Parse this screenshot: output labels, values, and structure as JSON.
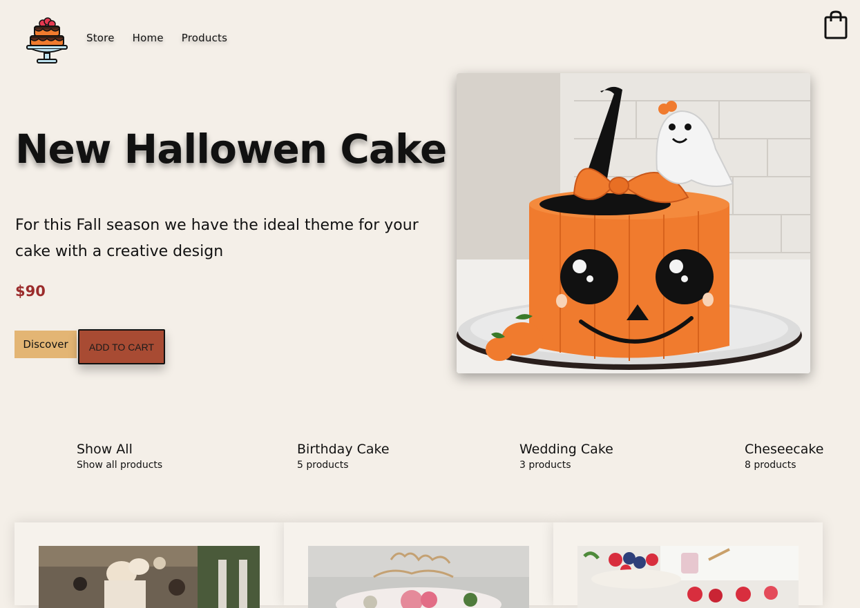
{
  "nav": {
    "items": [
      "Store",
      "Home",
      "Products"
    ]
  },
  "icons": {
    "logo": "cake-logo-icon",
    "cart": "shopping-bag-icon"
  },
  "hero": {
    "title": "New Hallowen Cake",
    "description": "For this Fall season we have the ideal theme for your cake with a creative design",
    "price": "$90",
    "discover_label": "Discover",
    "add_to_cart_label": "ADD TO CART"
  },
  "categories": [
    {
      "name": "Show All",
      "count": "Show all products"
    },
    {
      "name": "Birthday Cake",
      "count": "5 products"
    },
    {
      "name": "Wedding Cake",
      "count": "3 products"
    },
    {
      "name": "Cheseecake",
      "count": "8 products"
    }
  ],
  "colors": {
    "background": "#f4efe8",
    "price": "#9b2c2c",
    "discover_button": "#e3b574",
    "cart_button": "#a84b33",
    "pumpkin": "#f07b2e"
  }
}
